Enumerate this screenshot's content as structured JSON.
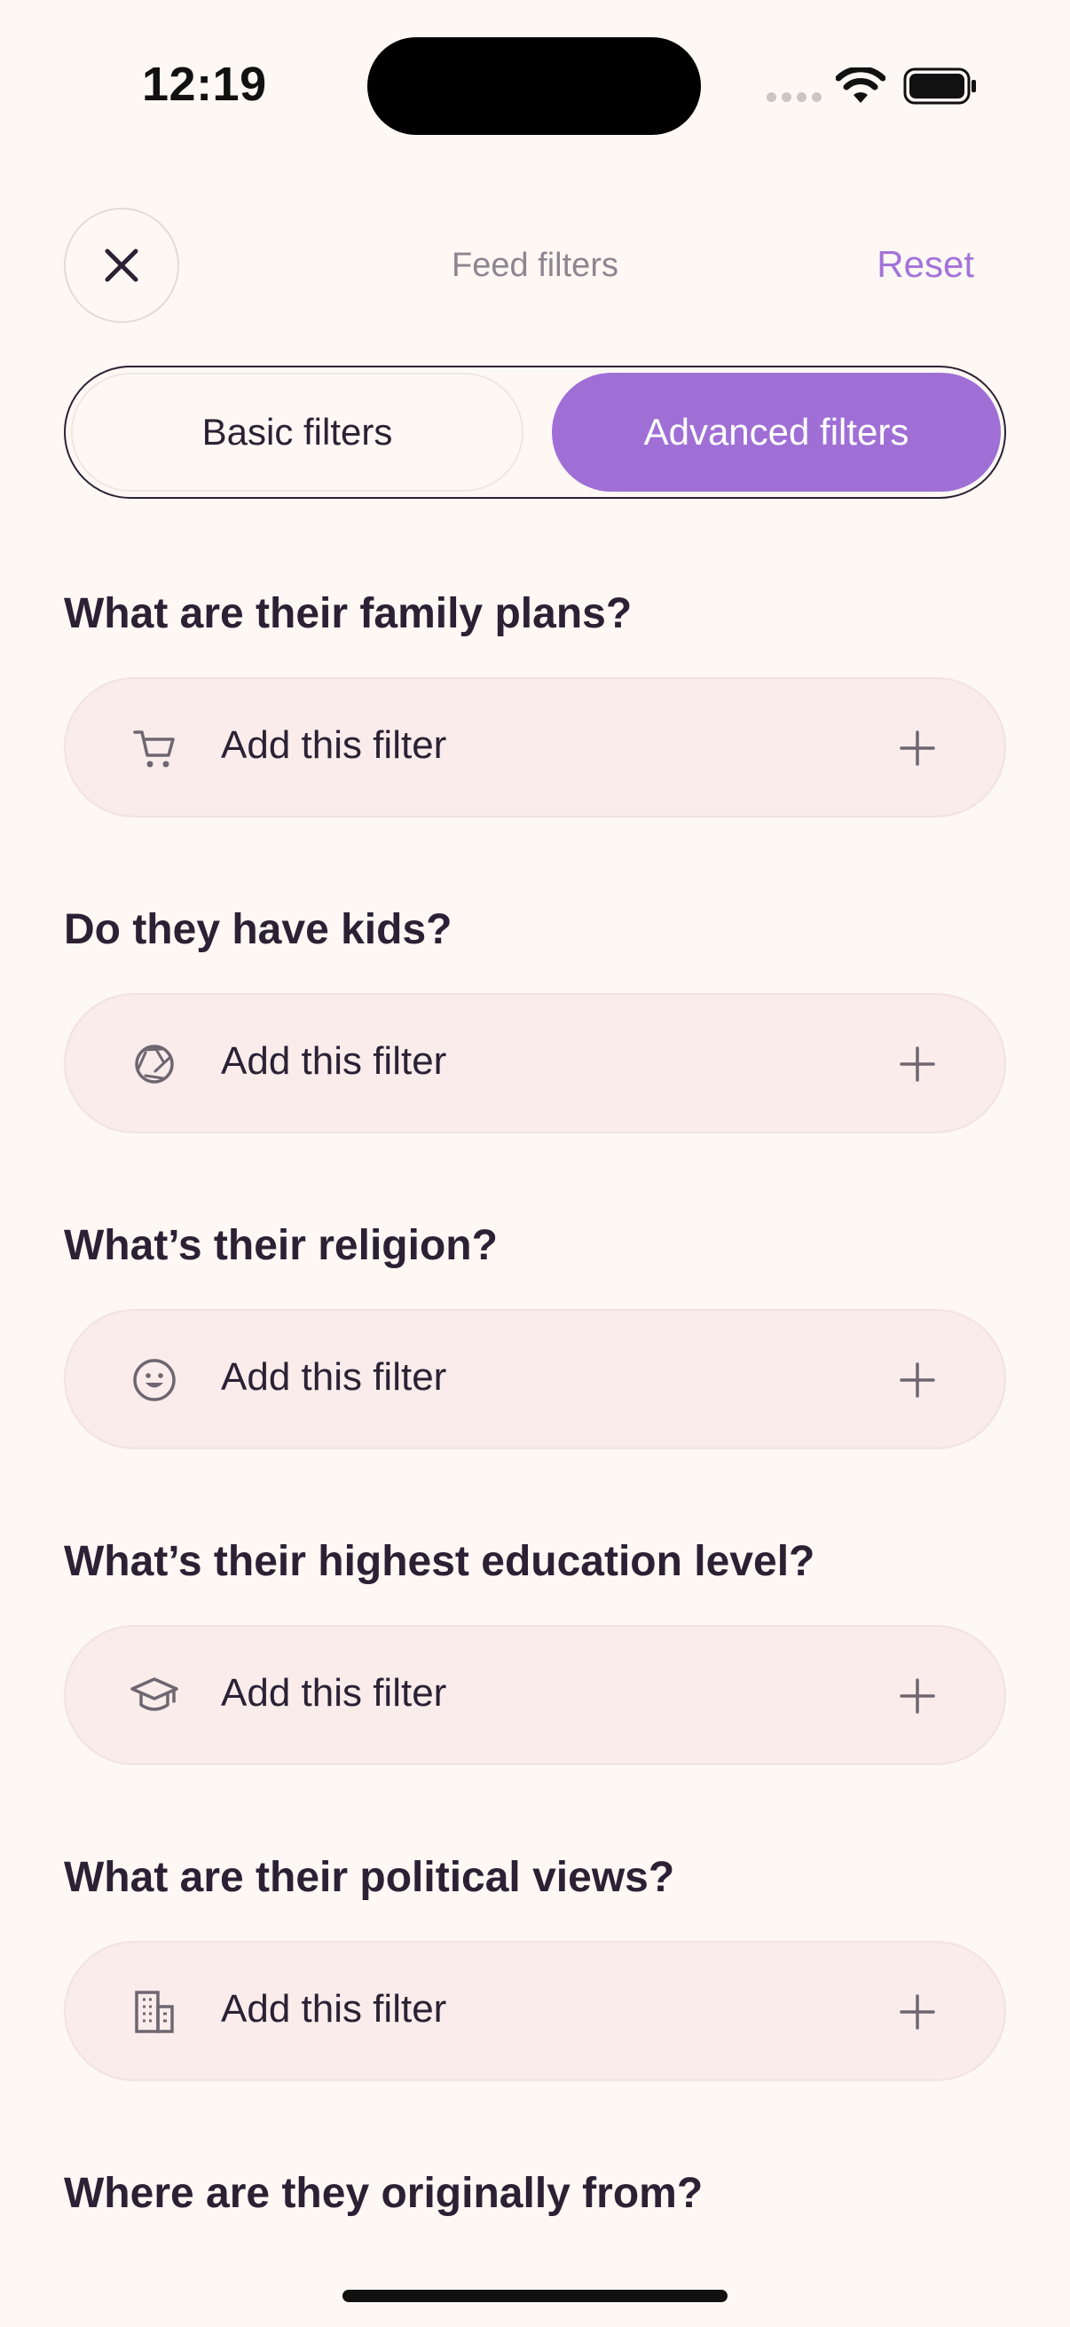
{
  "status_bar": {
    "time": "12:19"
  },
  "header": {
    "title": "Feed filters",
    "reset_label": "Reset"
  },
  "tabs": {
    "basic_label": "Basic filters",
    "advanced_label": "Advanced filters",
    "active": "advanced"
  },
  "colors": {
    "accent": "#A06FD6",
    "row_bg": "#F9ECEB",
    "background": "#FDF8F4"
  },
  "sections": [
    {
      "question": "What are their family plans?",
      "filter_label": "Add this filter",
      "icon": "cart-icon"
    },
    {
      "question": "Do they have kids?",
      "filter_label": "Add this filter",
      "icon": "aperture-icon"
    },
    {
      "question": "What’s their religion?",
      "filter_label": "Add this filter",
      "icon": "smiley-icon"
    },
    {
      "question": "What’s their highest education level?",
      "filter_label": "Add this filter",
      "icon": "graduation-cap-icon"
    },
    {
      "question": "What are their political views?",
      "filter_label": "Add this filter",
      "icon": "building-icon"
    },
    {
      "question": "Where are they originally from?"
    }
  ]
}
